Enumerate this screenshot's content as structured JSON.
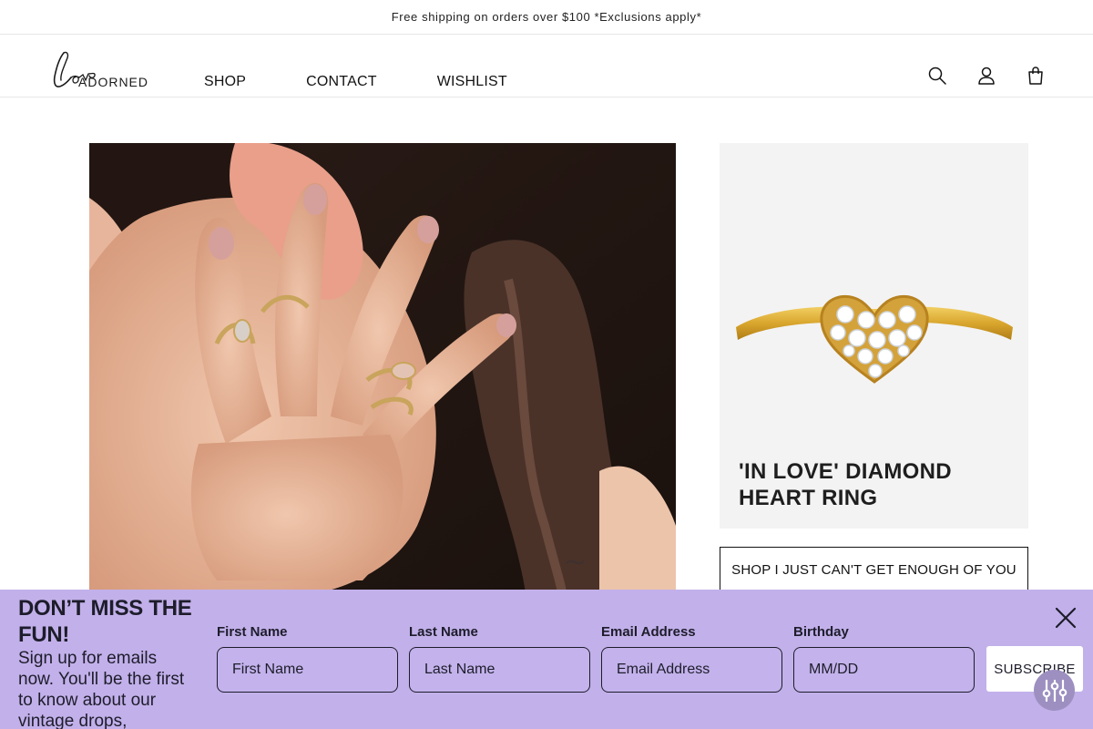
{
  "announcement": {
    "text": "Free shipping on orders over $100 *Exclusions apply*"
  },
  "header": {
    "logo": {
      "script": "Love",
      "word": "ADORNED"
    },
    "nav": [
      {
        "label": "SHOP"
      },
      {
        "label": "CONTACT"
      },
      {
        "label": "WISHLIST"
      }
    ],
    "icons": [
      "search-icon",
      "account-icon",
      "cart-icon"
    ]
  },
  "hero": {
    "image": "editorial photo of hand with gold rings against ear"
  },
  "product": {
    "image": "gold diamond heart ring",
    "title": "'IN LOVE' DIAMOND HEART RING"
  },
  "collection_button": {
    "label": "SHOP I JUST CAN'T GET ENOUGH OF YOU"
  },
  "signup": {
    "heading": "DON’T MISS THE FUN!",
    "description": "Sign up for emails now. You'll be the first to know about our vintage drops,",
    "fields": [
      {
        "label": "First Name",
        "placeholder": "First Name"
      },
      {
        "label": "Last Name",
        "placeholder": "Last Name"
      },
      {
        "label": "Email Address",
        "placeholder": "Email Address"
      },
      {
        "label": "Birthday",
        "placeholder": "MM/DD"
      }
    ],
    "submit_label": "SUBSCRIBE",
    "close_icon": "close-icon",
    "background_color": "#c2b0ea"
  },
  "filter_button": {
    "icon": "sliders-icon"
  }
}
